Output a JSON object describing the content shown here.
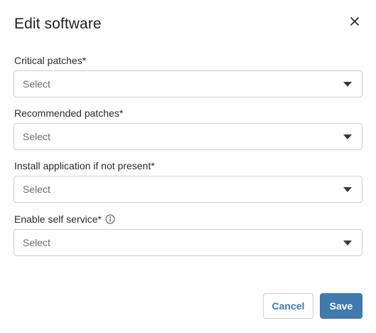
{
  "dialog": {
    "title": "Edit software",
    "close_icon": "close-icon",
    "fields": [
      {
        "label": "Critical patches*",
        "value": "Select"
      },
      {
        "label": "Recommended patches*",
        "value": "Select"
      },
      {
        "label": "Install application if not present*",
        "value": "Select"
      },
      {
        "label": "Enable self service*",
        "value": "Select",
        "icon": "info-icon"
      }
    ],
    "buttons": {
      "cancel_label": "Cancel",
      "save_label": "Save"
    }
  },
  "colors": {
    "accent": "#3f79ad",
    "border": "#cfcfcf",
    "placeholder": "#6b6b6b"
  }
}
